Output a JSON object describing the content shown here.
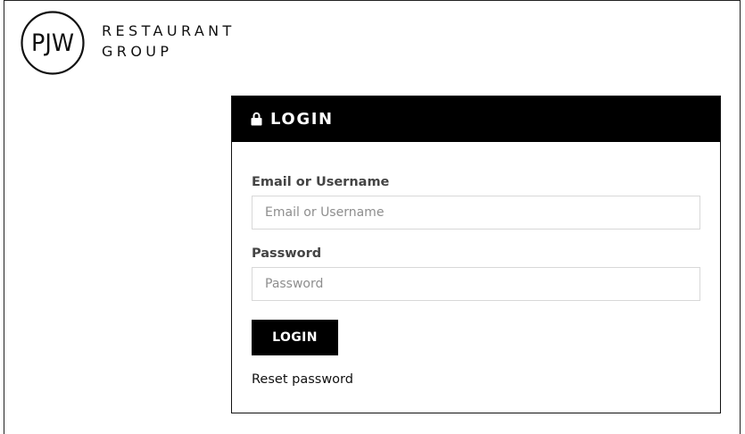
{
  "brand": {
    "logo_initials": "PJW",
    "name_line1": "RESTAURANT",
    "name_line2": "GROUP"
  },
  "login_card": {
    "title": "LOGIN",
    "title_icon": "lock-icon",
    "email_label": "Email or Username",
    "email_placeholder": "Email or Username",
    "email_value": "",
    "password_label": "Password",
    "password_placeholder": "Password",
    "password_value": "",
    "submit_label": "LOGIN",
    "reset_link": "Reset password"
  },
  "colors": {
    "header_bg": "#000000",
    "button_bg": "#000000",
    "input_border": "#d8d8d8",
    "label_text": "#444444"
  }
}
